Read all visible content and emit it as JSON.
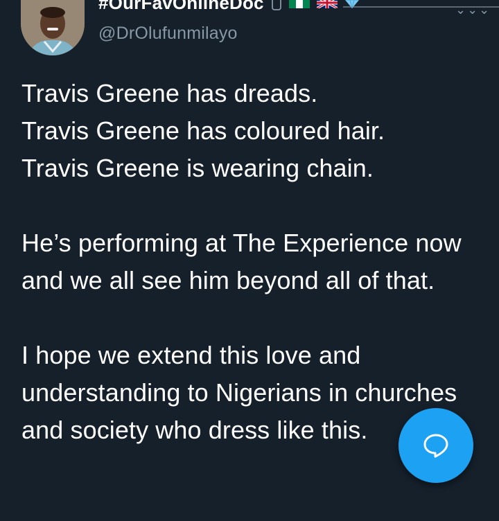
{
  "tweet": {
    "display_name": "#OurFavOnlineDoc",
    "handle": "@DrOlufunmilayo",
    "paragraphs": [
      "Travis Greene has dreads.\nTravis Greene has coloured hair.\nTravis Greene is wearing chain.",
      "He’s performing at The Experience now and we all see him beyond all of that.",
      "I hope we extend this love and understanding to Nigerians in churches and society who dress like this."
    ]
  },
  "icons": {
    "phone": "phone-icon",
    "flag_nigeria": "nigeria-flag-icon",
    "flag_uk": "uk-flag-icon",
    "verified": "diamond-icon",
    "more": "more-options-icon",
    "compose": "compose-reply-icon"
  },
  "colors": {
    "background": "#15202b",
    "text": "#ffffff",
    "secondary_text": "#8899a6",
    "accent": "#1da1f2"
  }
}
